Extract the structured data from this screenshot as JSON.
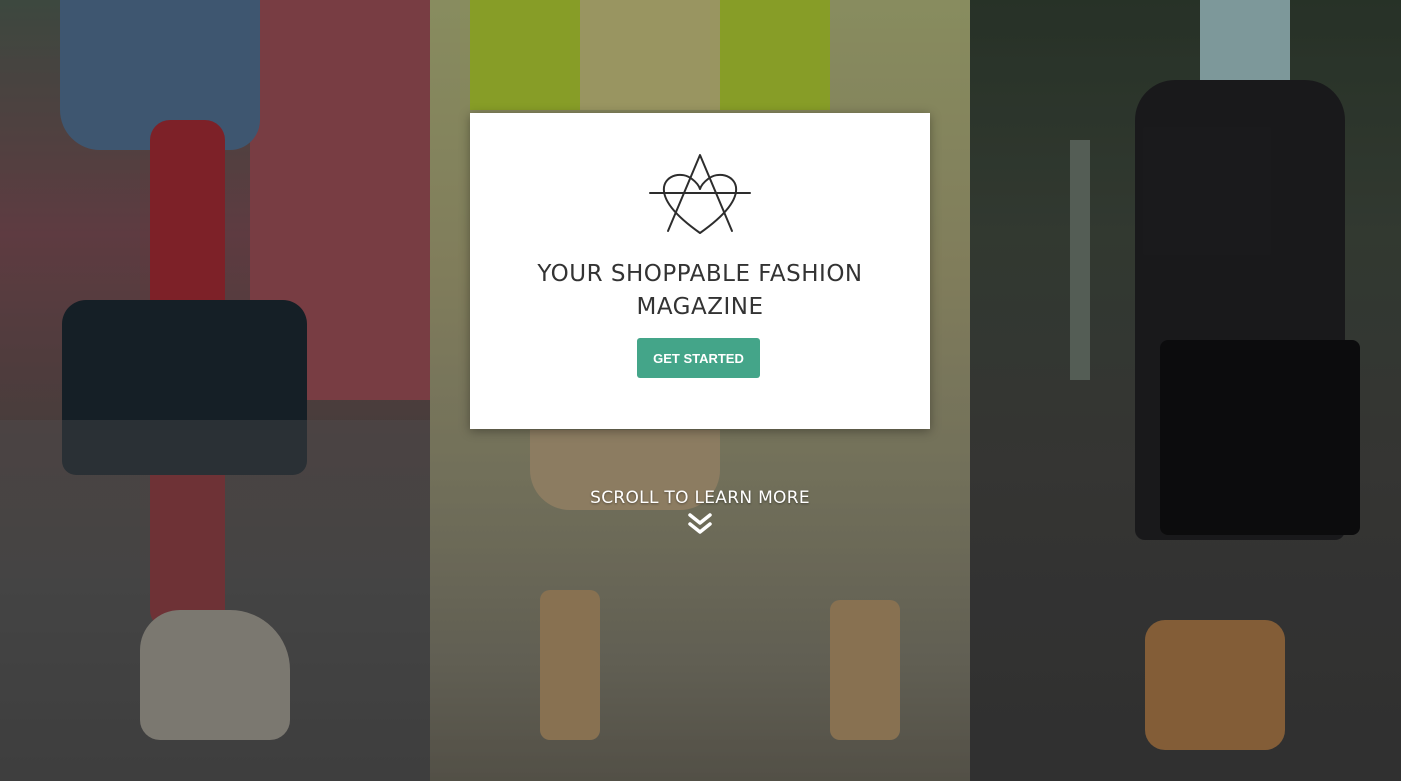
{
  "hero": {
    "panels": [
      {
        "label": "fashion-photo-red-jeans-handbag"
      },
      {
        "label": "fashion-photo-neon-blazer-heels"
      },
      {
        "label": "fashion-photo-pleated-skirt-handbag"
      }
    ]
  },
  "card": {
    "logo_icon": "heart-triangle-logo-icon",
    "tagline_line1": "YOUR SHOPPABLE FASHION",
    "tagline_line2": "MAGAZINE",
    "cta_label": "GET STARTED"
  },
  "scroll": {
    "label": "SCROLL TO LEARN MORE",
    "icon": "double-chevron-down-icon"
  },
  "colors": {
    "accent": "#44a589",
    "card_bg": "#ffffff",
    "text_dark": "#333333"
  }
}
